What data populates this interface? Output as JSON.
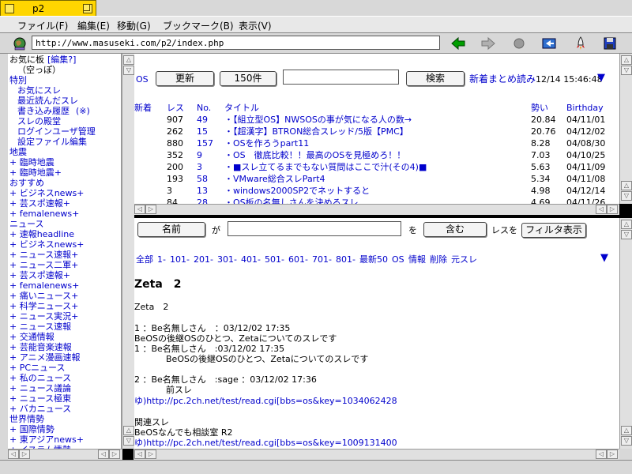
{
  "window": {
    "title": "p2"
  },
  "menu": [
    "ファイル(F)",
    "編集(E)",
    "移動(G)",
    "ブックマーク(B)",
    "表示(V)"
  ],
  "url": "http://www.masuseki.com/p2/index.php",
  "toolbar_icons": [
    "globe-icon",
    "back-icon",
    "forward-icon",
    "stop-icon",
    "home-icon",
    "rocket-icon",
    "save-icon"
  ],
  "colors": {
    "link": "#0000cc",
    "tab": "#ffd600",
    "back_arrow": "#00a000"
  },
  "sidebar": {
    "lines": [
      {
        "text": "お気に板",
        "cls": "blk"
      },
      {
        "text": "[編集?]",
        "cls": "lnk"
      },
      {
        "text": "（空っぽ）",
        "cls": "blk"
      },
      {
        "text": "特別",
        "cls": "cat"
      },
      {
        "text": "お気にスレ",
        "cls": "lnk"
      },
      {
        "text": "最近読んだスレ",
        "cls": "lnk"
      },
      {
        "text": "書き込み履歴",
        "cls": "lnk"
      },
      {
        "text": "(※)",
        "cls": "lnk"
      },
      {
        "text": "スレの殿堂",
        "cls": "lnk"
      },
      {
        "text": "ログインユーザ管理",
        "cls": "lnk"
      },
      {
        "text": "設定ファイル編集",
        "cls": "lnk"
      },
      {
        "text": "地震",
        "cls": "cat"
      },
      {
        "text": "+ 臨時地震",
        "cls": "lnk"
      },
      {
        "text": "+ 臨時地震+",
        "cls": "lnk"
      },
      {
        "text": "おすすめ",
        "cls": "cat"
      },
      {
        "text": "+ ビジネスnews+",
        "cls": "lnk"
      },
      {
        "text": "+ 芸スポ速報+",
        "cls": "lnk"
      },
      {
        "text": "+ femalenews+",
        "cls": "lnk"
      },
      {
        "text": "ニュース",
        "cls": "cat"
      },
      {
        "text": "+ 速報headline",
        "cls": "lnk"
      },
      {
        "text": "+ ビジネスnews+",
        "cls": "lnk"
      },
      {
        "text": "+ ニュース速報+",
        "cls": "lnk"
      },
      {
        "text": "+ ニュース二軍+",
        "cls": "lnk"
      },
      {
        "text": "+ 芸スポ速報+",
        "cls": "lnk"
      },
      {
        "text": "+ femalenews+",
        "cls": "lnk"
      },
      {
        "text": "+ 痛いニュース+",
        "cls": "lnk"
      },
      {
        "text": "+ 科学ニュース+",
        "cls": "lnk"
      },
      {
        "text": "+ ニュース実況+",
        "cls": "lnk"
      },
      {
        "text": "+ ニュース速報",
        "cls": "lnk"
      },
      {
        "text": "+ 交通情報",
        "cls": "lnk"
      },
      {
        "text": "+ 芸能音楽速報",
        "cls": "lnk"
      },
      {
        "text": "+ アニメ漫画速報",
        "cls": "lnk"
      },
      {
        "text": "+ PCニュース",
        "cls": "lnk"
      },
      {
        "text": "+ 私のニュース",
        "cls": "lnk"
      },
      {
        "text": "+ ニュース議論",
        "cls": "lnk"
      },
      {
        "text": "+ ニュース極東",
        "cls": "lnk"
      },
      {
        "text": "+ バカニュース",
        "cls": "lnk"
      },
      {
        "text": "世界情勢",
        "cls": "cat"
      },
      {
        "text": "+ 国際情勢",
        "cls": "lnk"
      },
      {
        "text": "+ 東アジアnews+",
        "cls": "lnk"
      },
      {
        "text": "+ イスラム情勢",
        "cls": "lnk"
      }
    ]
  },
  "board": {
    "name": "OS",
    "refresh_label": "更新",
    "count_label": "150件",
    "search_value": "",
    "search_label": "検索",
    "summary_link": "新着まとめ読み",
    "timestamp": "12/14 15:46:48",
    "headers": {
      "new": "新着",
      "res": "レス",
      "no": "No.",
      "title": "タイトル",
      "ikioi": "勢い",
      "birthday": "Birthday"
    },
    "threads": [
      {
        "new": "",
        "res": "907",
        "no": "49",
        "title": "・【組立型OS】NWSOSの事が気になる人の数→",
        "ikioi": "20.84",
        "birthday": "04/11/01"
      },
      {
        "new": "",
        "res": "262",
        "no": "15",
        "title": "・【超漢字】BTRON総合スレッド/5版【PMC】",
        "ikioi": "20.76",
        "birthday": "04/12/02"
      },
      {
        "new": "",
        "res": "880",
        "no": "157",
        "title": "・OSを作ろうpart11",
        "ikioi": "8.28",
        "birthday": "04/08/30"
      },
      {
        "new": "",
        "res": "352",
        "no": "9",
        "title": "・OS　徹底比較！！最高のOSを見極めろ！！",
        "ikioi": "7.03",
        "birthday": "04/10/25"
      },
      {
        "new": "",
        "res": "200",
        "no": "3",
        "title": "・■スレ立てるまでもない質問はここで汁(その4)■",
        "ikioi": "5.63",
        "birthday": "04/11/09"
      },
      {
        "new": "",
        "res": "193",
        "no": "58",
        "title": "・VMware総合スレPart4",
        "ikioi": "5.34",
        "birthday": "04/11/08"
      },
      {
        "new": "",
        "res": "3",
        "no": "13",
        "title": "・windows2000SP2でネットすると",
        "ikioi": "4.98",
        "birthday": "04/12/14"
      },
      {
        "new": "",
        "res": "84",
        "no": "28",
        "title": "・OS板の名無しさんを決めるスレ",
        "ikioi": "4.69",
        "birthday": "04/11/26"
      }
    ]
  },
  "filter": {
    "field_label": "名前",
    "ga": "が",
    "input_value": "",
    "wo": "を",
    "match_label": "含む",
    "res_wo": "レスを",
    "show_label": "フィルタ表示"
  },
  "thread": {
    "nav": [
      "全部",
      "1-",
      "101-",
      "201-",
      "301-",
      "401-",
      "501-",
      "601-",
      "701-",
      "801-",
      "最新50"
    ],
    "right_nav": [
      "OS",
      "情報",
      "削除",
      "元スレ"
    ],
    "title_bold": "Zeta　2",
    "title_plain": "Zeta　2",
    "posts": [
      {
        "head": "1 ：Be名無しさん　：03/12/02 17:35"
      },
      {
        "body": "BeOSの後継OSのひとつ、Zetaについてのスレです"
      },
      {
        "head": "1 ：Be名無しさん　:03/12/02 17:35"
      },
      {
        "body_indent": "BeOSの後継OSのひとつ、Zetaについてのスレです"
      },
      {
        "head": "2 ：Be名無しさん　:sage ：03/12/02 17:36"
      },
      {
        "body_indent": "前スレ"
      },
      {
        "link": "ゆ)http://pc.2ch.net/test/read.cgi[bbs=os&key=1034062428"
      },
      {
        "plain": "関連スレ"
      },
      {
        "plain": "BeOSなんでも相談室 R2"
      },
      {
        "link": "ゆ)http://pc.2ch.net/test/read.cgi[bbs=os&key=1009131400"
      }
    ]
  }
}
